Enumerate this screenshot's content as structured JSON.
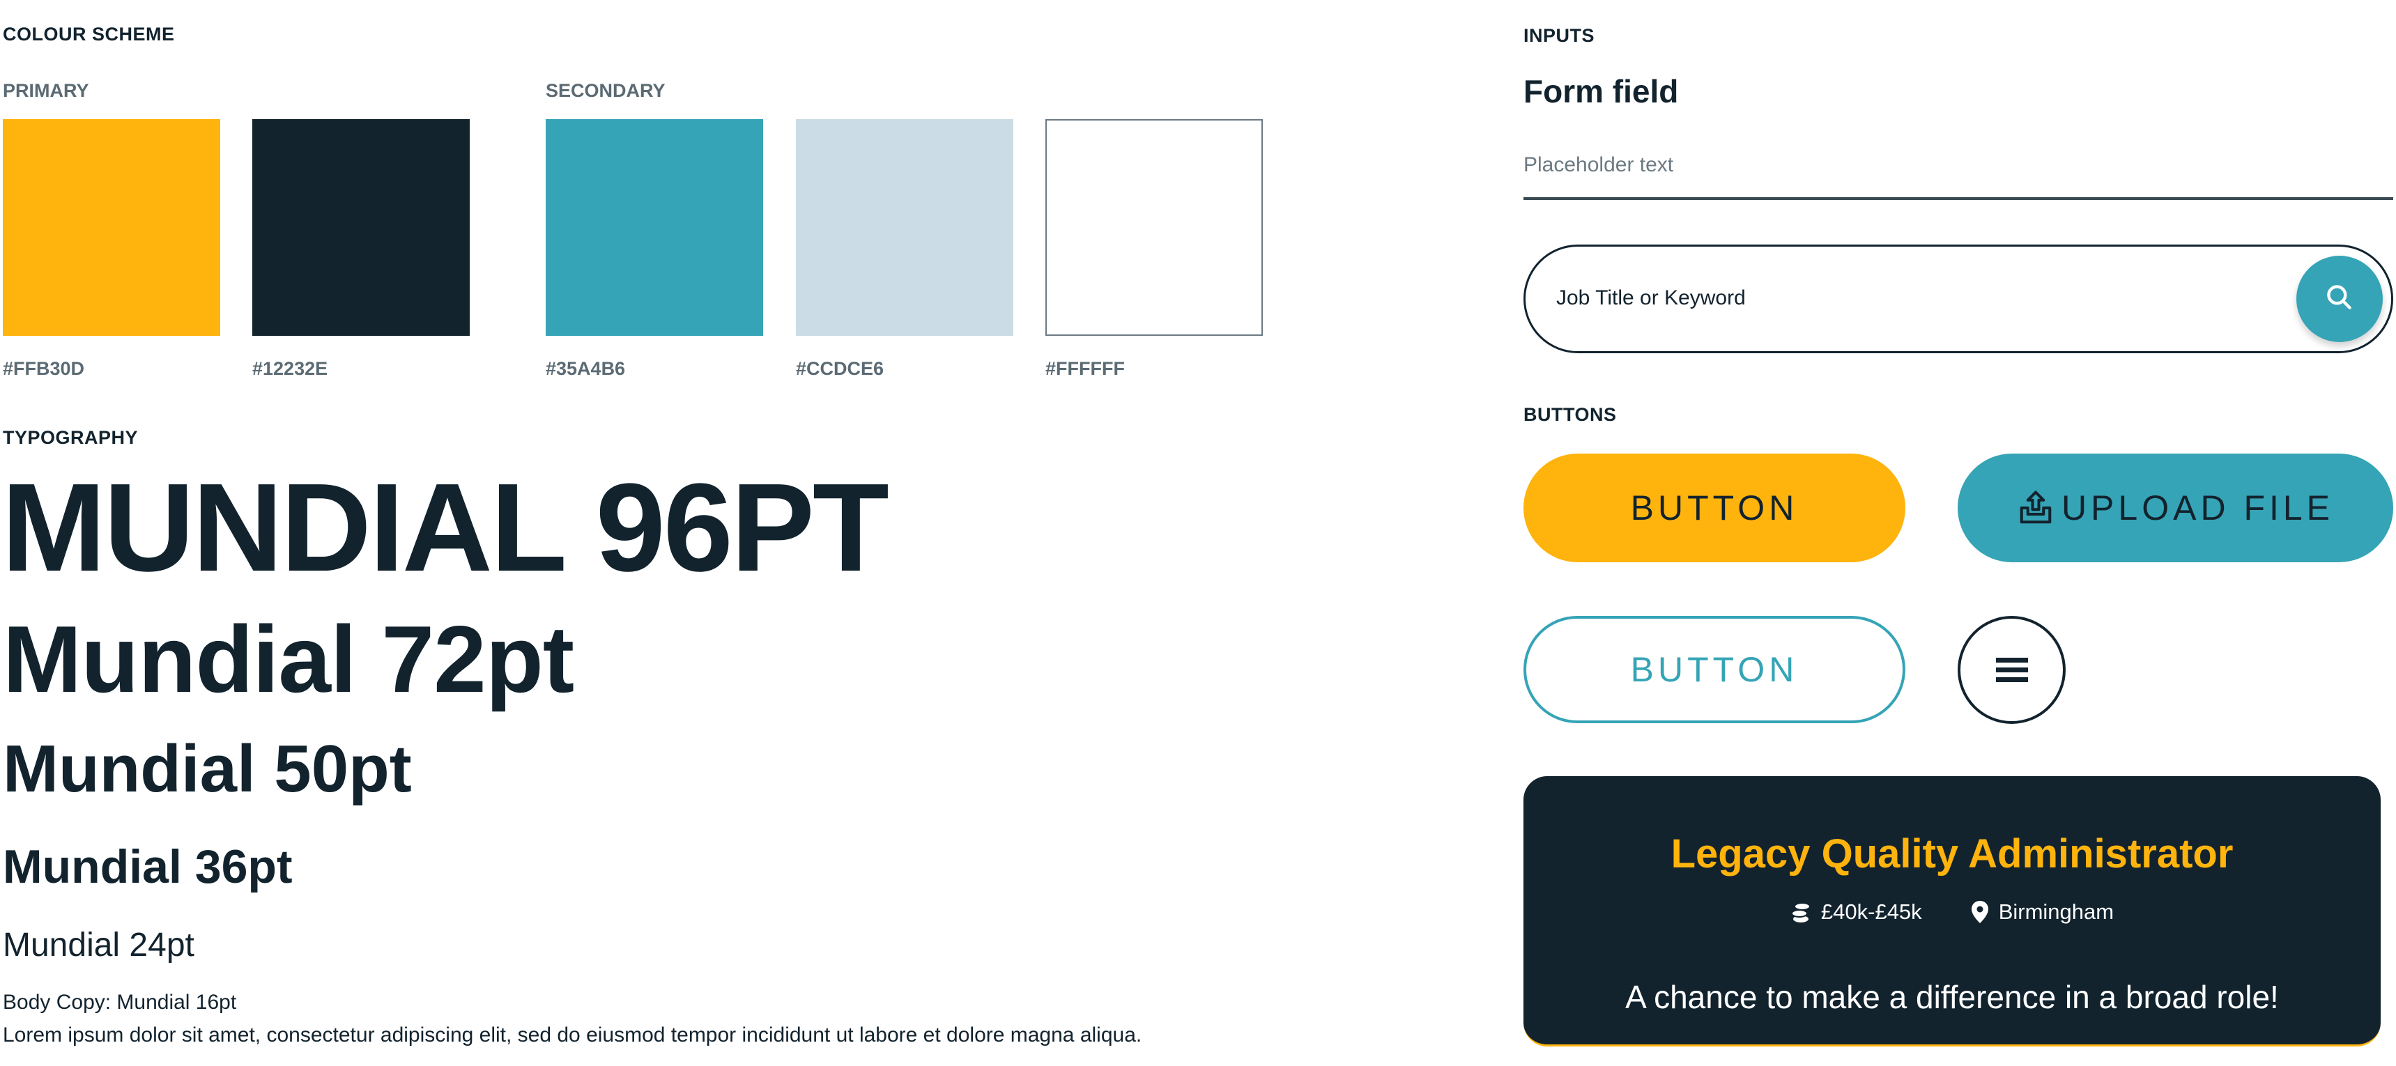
{
  "colour_scheme": {
    "title": "COLOUR SCHEME",
    "primary_label": "PRIMARY",
    "secondary_label": "SECONDARY",
    "swatches": [
      {
        "group": "primary",
        "hex": "#FFB30D",
        "color": "#FFB30D"
      },
      {
        "group": "primary",
        "hex": "#12232E",
        "color": "#12232E"
      },
      {
        "group": "secondary",
        "hex": "#35A4B6",
        "color": "#35A4B6"
      },
      {
        "group": "secondary",
        "hex": "#CCDCE6",
        "color": "#CCDCE6"
      },
      {
        "group": "secondary",
        "hex": "#FFFFFF",
        "color": "#FFFFFF"
      }
    ]
  },
  "typography": {
    "title": "TYPOGRAPHY",
    "samples": {
      "pt96": "MUNDIAL 96PT",
      "pt72": "Mundial 72pt",
      "pt50": "Mundial 50pt",
      "pt36": "Mundial 36pt",
      "pt24": "Mundial 24pt",
      "body_label": "Body Copy: Mundial 16pt",
      "body_text": "Lorem ipsum dolor sit amet, consectetur adipiscing elit, sed do eiusmod tempor incididunt ut labore et dolore magna aliqua."
    }
  },
  "inputs": {
    "title": "INPUTS",
    "form_field_label": "Form field",
    "form_field_placeholder": "Placeholder text",
    "search_placeholder": "Job Title or Keyword",
    "search_icon": "search-icon"
  },
  "buttons": {
    "title": "BUTTONS",
    "primary_label": "BUTTON",
    "upload_label": "UPLOAD FILE",
    "upload_icon": "upload-icon",
    "outline_label": "BUTTON",
    "menu_icon": "hamburger-menu-icon"
  },
  "job_card": {
    "title": "Legacy Quality Administrator",
    "salary": "£40k-£45k",
    "salary_icon": "coins-icon",
    "location": "Birmingham",
    "location_icon": "map-pin-icon",
    "tagline": "A chance to make a difference in a broad role!"
  },
  "colors": {
    "yellow": "#FFB30D",
    "navy": "#12232E",
    "teal": "#35A4B6",
    "light_blue": "#CCDCE6",
    "white": "#FFFFFF"
  }
}
